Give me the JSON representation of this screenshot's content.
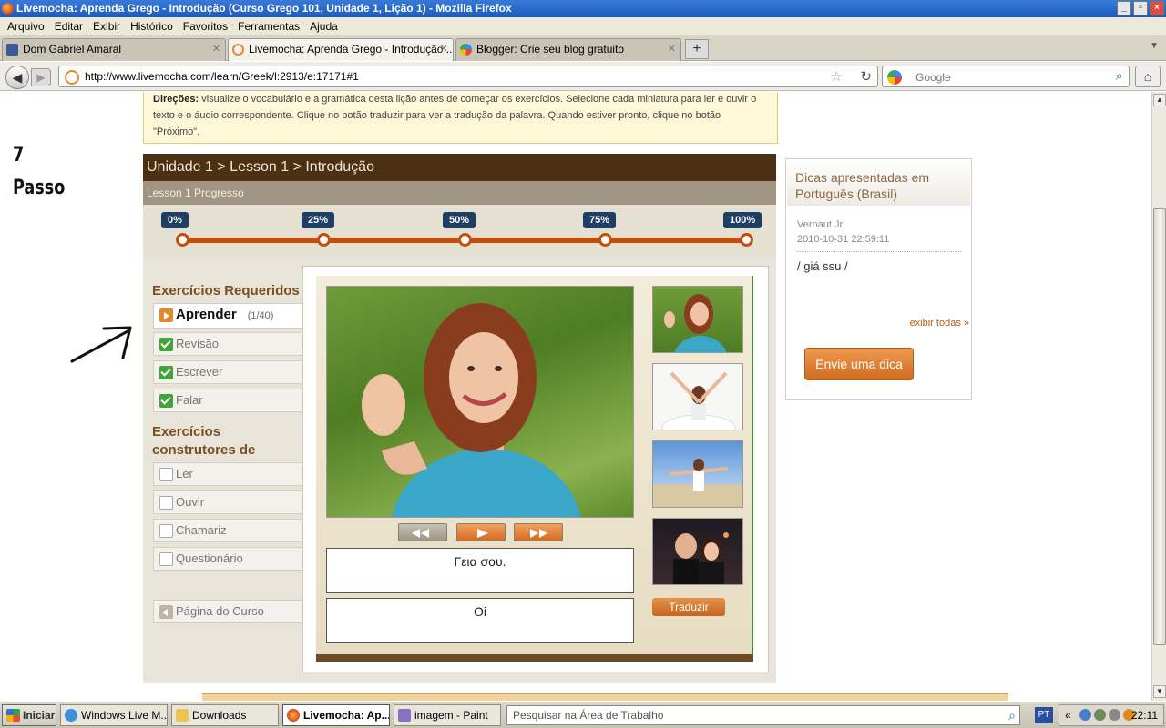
{
  "window": {
    "title": "Livemocha: Aprenda Grego - Introdução (Curso Grego 101, Unidade 1, Lição 1) - Mozilla Firefox",
    "controls": [
      "_",
      "▫",
      "×"
    ]
  },
  "menubar": [
    "Arquivo",
    "Editar",
    "Exibir",
    "Histórico",
    "Favoritos",
    "Ferramentas",
    "Ajuda"
  ],
  "tabs": [
    {
      "label": "Dom Gabriel Amaral",
      "icon": "facebook-icon",
      "color": "#3b5998"
    },
    {
      "label": "Livemocha: Aprenda Grego - Introdução ...",
      "icon": "livemocha-icon",
      "color": "#e08a3a"
    },
    {
      "label": "Blogger: Crie seu blog gratuito",
      "icon": "google-icon",
      "color": "#4285f4"
    }
  ],
  "newtab_label": "+",
  "navbar": {
    "url": "http://www.livemocha.com/learn/Greek/l:2913/e:17171#1",
    "search_placeholder": "Google"
  },
  "page": {
    "directions_label": "Direções:",
    "directions_text": " visualize o vocabulário e a gramática desta lição antes de começar os exercícios. Selecione cada miniatura para ler e ouvir o texto e o áudio correspondente. Clique no botão traduzir para ver a tradução da palavra. Quando estiver pronto, clique no botão \"Próximo\".",
    "annotation_number": "7",
    "annotation_word": "Passo",
    "breadcrumb": "Unidade 1 > Lesson 1 > Introdução",
    "progress_title": "Lesson 1 Progresso",
    "progress_marks": [
      "0%",
      "25%",
      "50%",
      "75%",
      "100%"
    ],
    "progress_value": 0.025,
    "required_title": "Exercícios Requeridos",
    "required": [
      {
        "label": "Aprender",
        "count": "(1/40)",
        "state": "current"
      },
      {
        "label": "Revisão",
        "state": "done"
      },
      {
        "label": "Escrever",
        "state": "done"
      },
      {
        "label": "Falar",
        "state": "done"
      }
    ],
    "builders_title": "Exercícios construtores de habilidades",
    "builders": [
      "Ler",
      "Ouvir",
      "Chamariz",
      "Questionário"
    ],
    "course_page": "Página do Curso",
    "greek_text": "Γεια σου.",
    "translation_text": "Oi",
    "translate_button": "Traduzir",
    "tips": {
      "title": "Dicas apresentadas em Português (Brasil)",
      "author": "Vernaut Jr",
      "date": "2010-10-31 22:59:11",
      "text": "/ giá ssu /",
      "show_all": "exibir todas »",
      "send_button": "Envie uma dica"
    }
  },
  "taskbar": {
    "start": "Iniciar",
    "buttons": [
      {
        "label": "Windows Live M...",
        "color": "#3d8fd8",
        "active": false
      },
      {
        "label": "Downloads",
        "color": "#f0c44c",
        "active": false
      },
      {
        "label": "Livemocha: Ap...",
        "color": "#e2581b",
        "active": true
      },
      {
        "label": "imagem - Paint",
        "color": "#8b6fc2",
        "active": false
      }
    ],
    "search_placeholder": "Pesquisar na Área de Trabalho",
    "language": "PT",
    "tray_chevron": "«",
    "clock": "22:11"
  }
}
